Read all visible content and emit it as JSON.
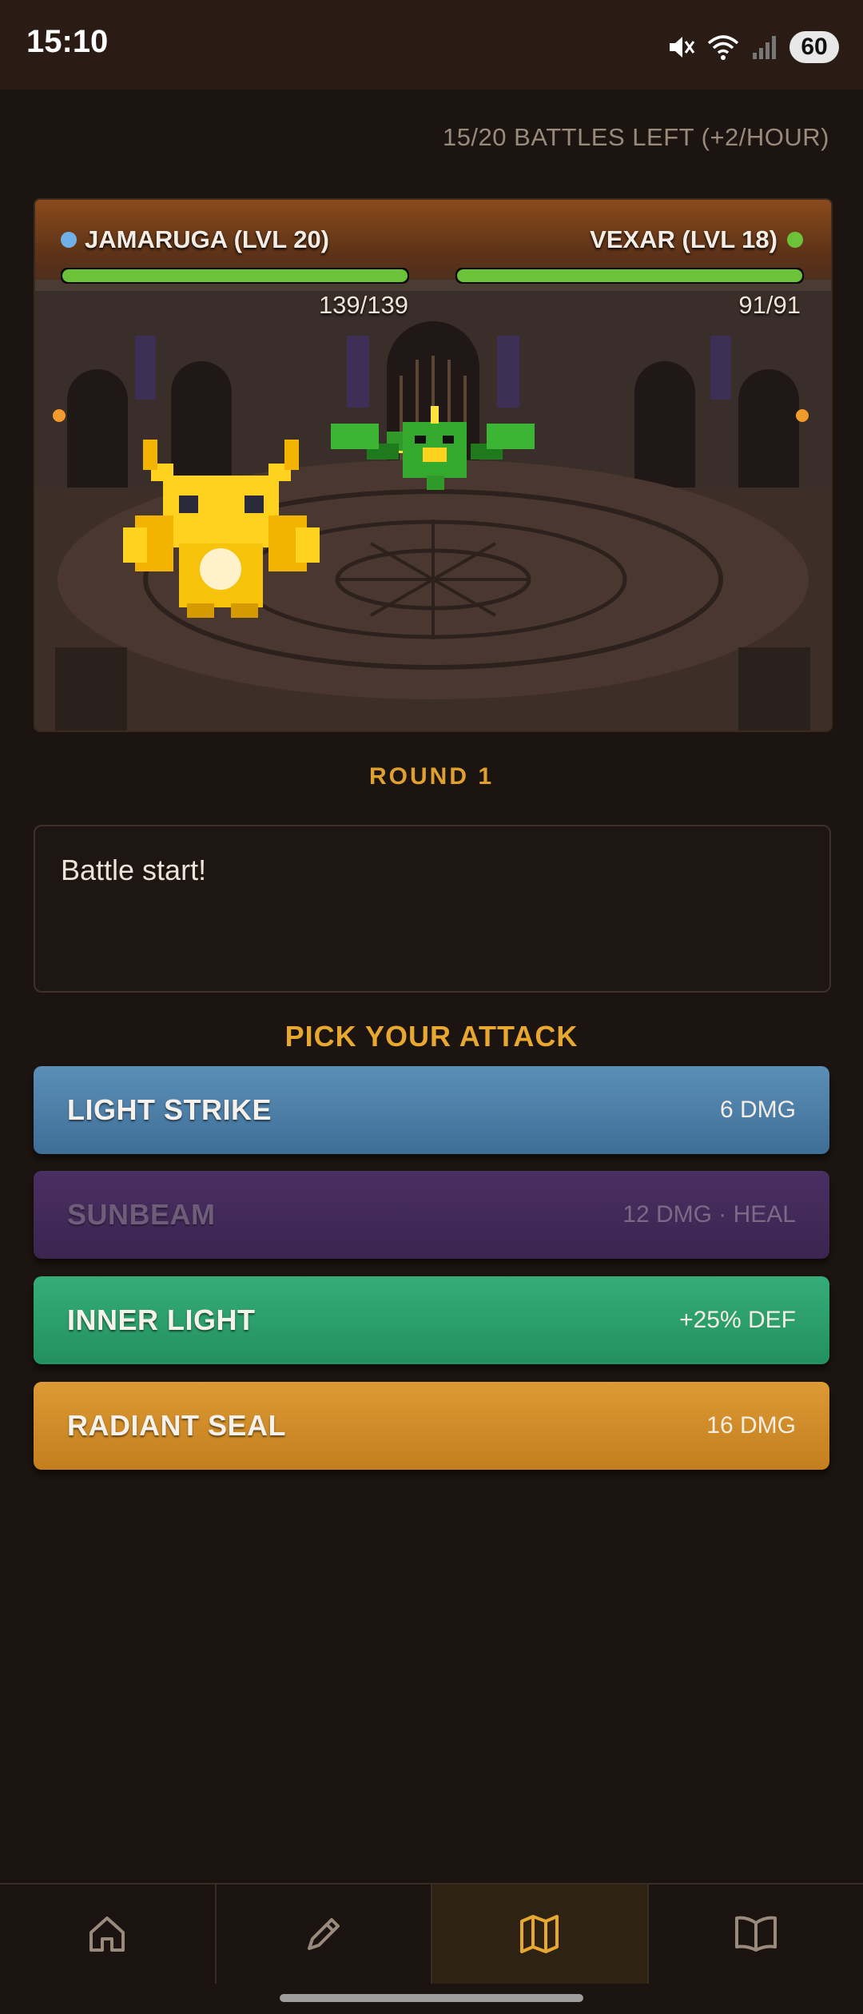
{
  "status_bar": {
    "time": "15:10",
    "battery": "60"
  },
  "battles_left": "15/20 BATTLES LEFT (+2/HOUR)",
  "battle": {
    "player": {
      "name": "JAMARUGA (LVL 20)",
      "hp_text": "139/139",
      "hp_fraction": 1.0,
      "dot_color": "#6fb1e6"
    },
    "enemy": {
      "name": "VEXAR (LVL 18)",
      "hp_text": "91/91",
      "hp_fraction": 1.0,
      "dot_color": "#6cc33a"
    }
  },
  "round_label": "ROUND 1",
  "log_text": "Battle start!",
  "pick_label": "PICK YOUR ATTACK",
  "attacks": [
    {
      "name": "LIGHT STRIKE",
      "stat": "6 DMG",
      "enabled": true,
      "color": "#4f82ab"
    },
    {
      "name": "SUNBEAM",
      "stat": "12 DMG · HEAL",
      "enabled": false,
      "color": "#432b59"
    },
    {
      "name": "INNER LIGHT",
      "stat": "+25% DEF",
      "enabled": true,
      "color": "#2ba06b"
    },
    {
      "name": "RADIANT SEAL",
      "stat": "16 DMG",
      "enabled": true,
      "color": "#d28c2a"
    }
  ],
  "nav": [
    {
      "icon": "home-icon",
      "active": false
    },
    {
      "icon": "pencil-icon",
      "active": false
    },
    {
      "icon": "map-icon",
      "active": true
    },
    {
      "icon": "book-icon",
      "active": false
    }
  ],
  "colors": {
    "accent": "#e8a830",
    "background": "#1c1410",
    "hp_green": "#6cc33a"
  }
}
